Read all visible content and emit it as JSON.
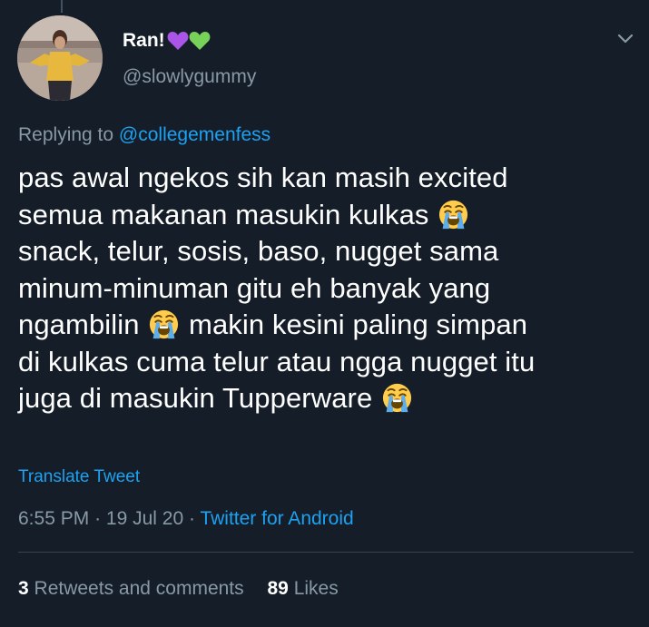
{
  "tweet": {
    "author": {
      "display_name": "Ran!",
      "username": "@slowlygummy",
      "name_emojis": [
        "purple-heart",
        "green-heart"
      ]
    },
    "replying_prefix": "Replying to",
    "replying_to": "@collegemenfess",
    "text_lines": [
      "pas awal ngekos sih kan masih excited",
      "semua makanan masukin kulkas",
      "snack, telur, sosis, baso, nugget sama",
      "minum-minuman gitu eh banyak yang",
      "ngambilin",
      "makin kesini paling simpan",
      "di kulkas cuma telur atau ngga nugget itu",
      "juga di masukin Tupperware"
    ],
    "translate_label": "Translate Tweet",
    "time": "6:55 PM",
    "date": "19 Jul 20",
    "separator": "·",
    "source": "Twitter for Android",
    "retweets_count": "3",
    "retweets_label": "Retweets and comments",
    "likes_count": "89",
    "likes_label": "Likes"
  },
  "colors": {
    "background": "#151e28",
    "text_primary": "#ffffff",
    "text_secondary": "#8899a6",
    "accent": "#1da1f2",
    "divider": "#38444d"
  },
  "icons": {
    "menu": "chevron-down-icon",
    "emoji": "loudly-crying-face"
  }
}
